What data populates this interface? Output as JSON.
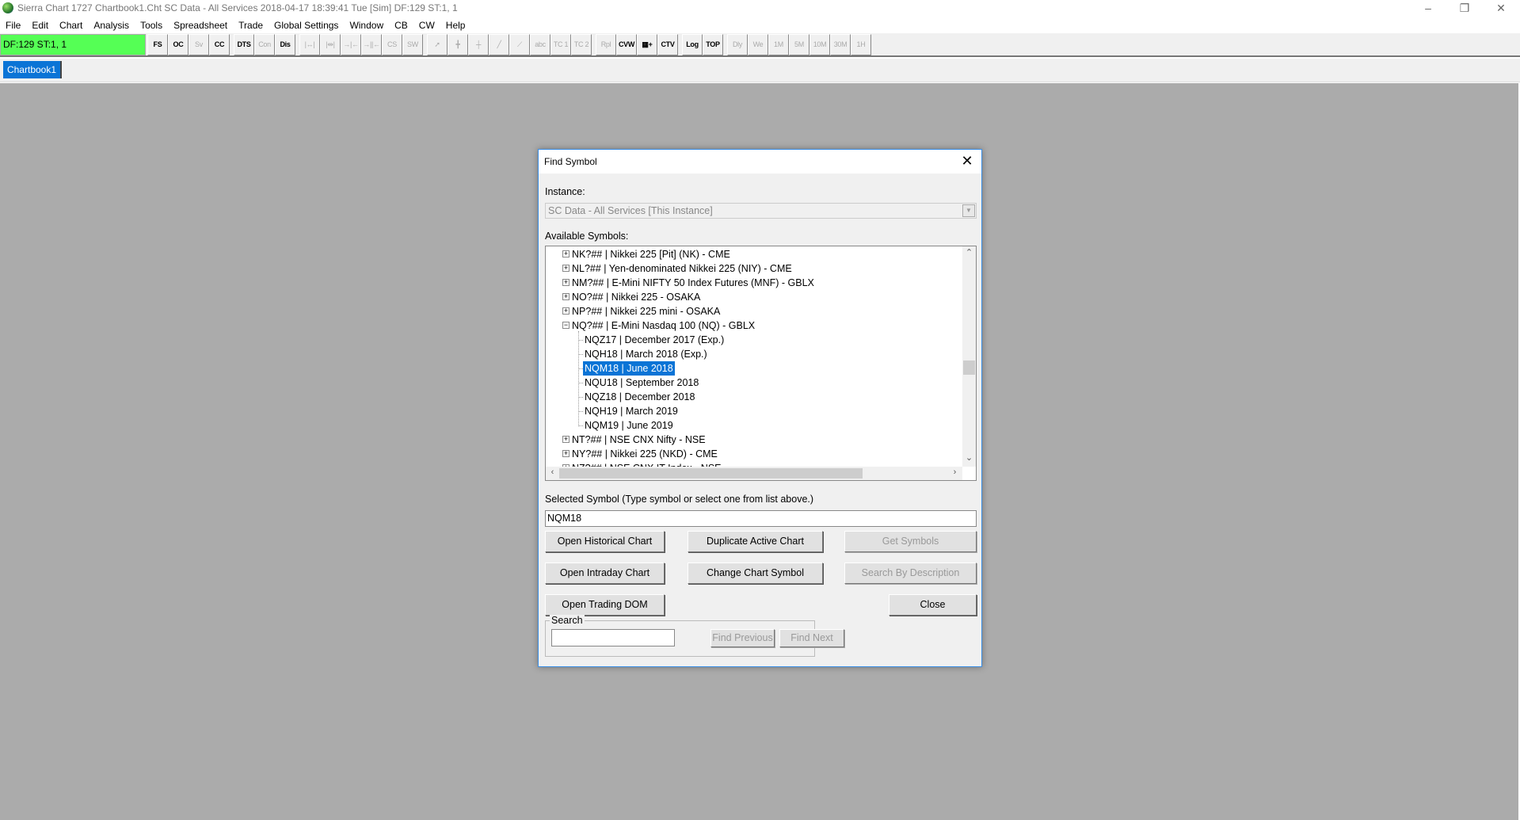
{
  "window": {
    "title": "Sierra Chart 1727 Chartbook1.Cht  SC Data - All Services 2018-04-17  18:39:41 Tue [Sim]  DF:129  ST:1, 1",
    "minimize": "–",
    "restore": "❐",
    "close": "✕"
  },
  "menu": [
    "File",
    "Edit",
    "Chart",
    "Analysis",
    "Tools",
    "Spreadsheet",
    "Trade",
    "Global Settings",
    "Window",
    "CB",
    "CW",
    "Help"
  ],
  "toolbar": {
    "status": "DF:129  ST:1, 1",
    "status_color": "#55ff55",
    "buttons": [
      {
        "label": "FS",
        "enabled": true
      },
      {
        "label": "OC",
        "enabled": true
      },
      {
        "label": "Sv",
        "enabled": false
      },
      {
        "label": "CC",
        "enabled": true
      },
      {
        "label": "DTS",
        "enabled": true,
        "group": true
      },
      {
        "label": "Con",
        "enabled": false
      },
      {
        "label": "Dis",
        "enabled": true
      },
      {
        "label": "|↔|",
        "enabled": false,
        "group": true
      },
      {
        "label": "|⇹|",
        "enabled": false
      },
      {
        "label": "→|←",
        "enabled": false
      },
      {
        "label": "→||←",
        "enabled": false
      },
      {
        "label": "CS",
        "enabled": false
      },
      {
        "label": "SW",
        "enabled": false
      },
      {
        "label": "➚",
        "enabled": false,
        "group": true
      },
      {
        "label": "╋",
        "enabled": false
      },
      {
        "label": "┼",
        "enabled": false
      },
      {
        "label": "╱",
        "enabled": false
      },
      {
        "label": "⟋",
        "enabled": false
      },
      {
        "label": "abc",
        "enabled": false
      },
      {
        "label": "TC 1",
        "enabled": false
      },
      {
        "label": "TC 2",
        "enabled": false
      },
      {
        "label": "Rpl",
        "enabled": false,
        "group": true
      },
      {
        "label": "CVW",
        "enabled": true
      },
      {
        "label": "▦+",
        "enabled": true
      },
      {
        "label": "CTV",
        "enabled": true
      },
      {
        "label": "Log",
        "enabled": true,
        "group": true
      },
      {
        "label": "TOP",
        "enabled": true
      },
      {
        "label": "Dly",
        "enabled": false,
        "group": true
      },
      {
        "label": "We",
        "enabled": false
      },
      {
        "label": "1M",
        "enabled": false
      },
      {
        "label": "5M",
        "enabled": false
      },
      {
        "label": "10M",
        "enabled": false
      },
      {
        "label": "30M",
        "enabled": false
      },
      {
        "label": "1H",
        "enabled": false
      }
    ]
  },
  "tabs": [
    {
      "label": "Chartbook1",
      "active": true
    }
  ],
  "dialog": {
    "title": "Find Symbol",
    "close": "✕",
    "instance_label": "Instance:",
    "instance_value": "SC Data - All Services [This Instance]",
    "available_label": "Available Symbols:",
    "tree": [
      {
        "text": "NK?##  |  Nikkei 225 [Pit] (NK) - CME",
        "level": 0,
        "expander": "+"
      },
      {
        "text": "NL?##  |  Yen-denominated Nikkei 225 (NIY) - CME",
        "level": 0,
        "expander": "+"
      },
      {
        "text": "NM?##  |  E-Mini NIFTY 50 Index Futures (MNF) - GBLX",
        "level": 0,
        "expander": "+"
      },
      {
        "text": "NO?##  |  Nikkei 225 - OSAKA",
        "level": 0,
        "expander": "+"
      },
      {
        "text": "NP?##  |  Nikkei 225 mini - OSAKA",
        "level": 0,
        "expander": "+"
      },
      {
        "text": "NQ?##  |  E-Mini Nasdaq 100 (NQ) - GBLX",
        "level": 0,
        "expander": "−"
      },
      {
        "text": "NQZ17  |  December 2017 (Exp.)",
        "level": 1
      },
      {
        "text": "NQH18  |  March 2018 (Exp.)",
        "level": 1
      },
      {
        "text": "NQM18  |  June 2018",
        "level": 1,
        "selected": true
      },
      {
        "text": "NQU18  |  September 2018",
        "level": 1
      },
      {
        "text": "NQZ18  |  December 2018",
        "level": 1
      },
      {
        "text": "NQH19  |  March 2019",
        "level": 1
      },
      {
        "text": "NQM19  |  June 2019",
        "level": 1
      },
      {
        "text": "NT?##  |  NSE CNX Nifty - NSE",
        "level": 0,
        "expander": "+"
      },
      {
        "text": "NY?##  |  Nikkei 225 (NKD) - CME",
        "level": 0,
        "expander": "+"
      },
      {
        "text": "NZ?##  |  NSE CNX IT Index - NSE",
        "level": 0,
        "expander": "+"
      }
    ],
    "selected_label": "Selected Symbol (Type symbol or select one from list above.)",
    "selected_value": "NQM18",
    "buttons": {
      "open_historical": "Open Historical Chart",
      "duplicate_active": "Duplicate Active Chart",
      "get_symbols": "Get Symbols",
      "open_intraday": "Open Intraday Chart",
      "change_symbol": "Change Chart Symbol",
      "search_by_description": "Search By Description",
      "open_dom": "Open Trading DOM",
      "close": "Close"
    },
    "search": {
      "label": "Search",
      "value": "",
      "find_previous": "Find Previous",
      "find_next": "Find Next"
    }
  }
}
